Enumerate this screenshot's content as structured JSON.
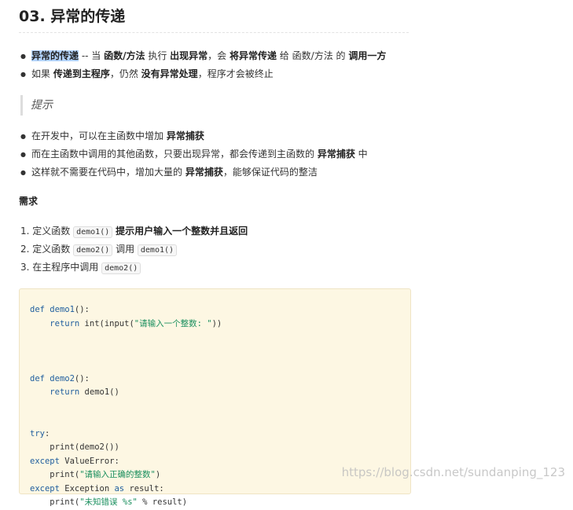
{
  "heading": "03. 异常的传递",
  "bullets1": [
    {
      "a": "异常的传递",
      "b": " -- 当 ",
      "c": "函数/方法",
      "d": " 执行 ",
      "e": "出现异常",
      "f": "，会 ",
      "g": "将异常传递",
      "h": " 给 函数/方法 的 ",
      "i": "调用一方"
    },
    {
      "a": "如果 ",
      "b": "传递到主程序",
      "c": "，仍然 ",
      "d": "没有异常处理",
      "e": "，程序才会被终止"
    }
  ],
  "quote": "提示",
  "bullets2": [
    {
      "a": "在开发中，可以在主函数中增加 ",
      "b": "异常捕获"
    },
    {
      "a": "而在主函数中调用的其他函数，只要出现异常，都会传递到主函数的 ",
      "b": "异常捕获",
      "c": " 中"
    },
    {
      "a": "这样就不需要在代码中，增加大量的 ",
      "b": "异常捕获",
      "c": "，能够保证代码的整洁"
    }
  ],
  "requirements_title": "需求",
  "steps": [
    {
      "n": "1. ",
      "a": "定义函数 ",
      "code": "demo1()",
      "b": " ",
      "c": "提示用户输入一个整数并且返回"
    },
    {
      "n": "2. ",
      "a": "定义函数 ",
      "code": "demo2()",
      "b": " 调用 ",
      "code2": "demo1()"
    },
    {
      "n": "3. ",
      "a": "在主程序中调用 ",
      "code": "demo2()"
    }
  ],
  "code": {
    "l1_kw": "def",
    "l1_fn": "demo1",
    "l1_rest": "():",
    "l2_kw": "return",
    "l2_a": " int(input(",
    "l2_str": "\"请输入一个整数: \"",
    "l2_b": "))",
    "l3_kw": "def",
    "l3_fn": "demo2",
    "l3_rest": "():",
    "l4_kw": "return",
    "l4_a": " demo1()",
    "l5_kw": "try",
    "l5_rest": ":",
    "l6": "print(demo2())",
    "l7_kw": "except",
    "l7_rest": " ValueError:",
    "l8_a": "print(",
    "l8_str": "\"请输入正确的整数\"",
    "l8_b": ")",
    "l9_kw": "except",
    "l9_a": " Exception ",
    "l9_kw2": "as",
    "l9_b": " result:",
    "l10_a": "print(",
    "l10_str": "\"未知错误 %s\"",
    "l10_b": " % result)"
  },
  "watermark": "https://blog.csdn.net/sundanping_123"
}
